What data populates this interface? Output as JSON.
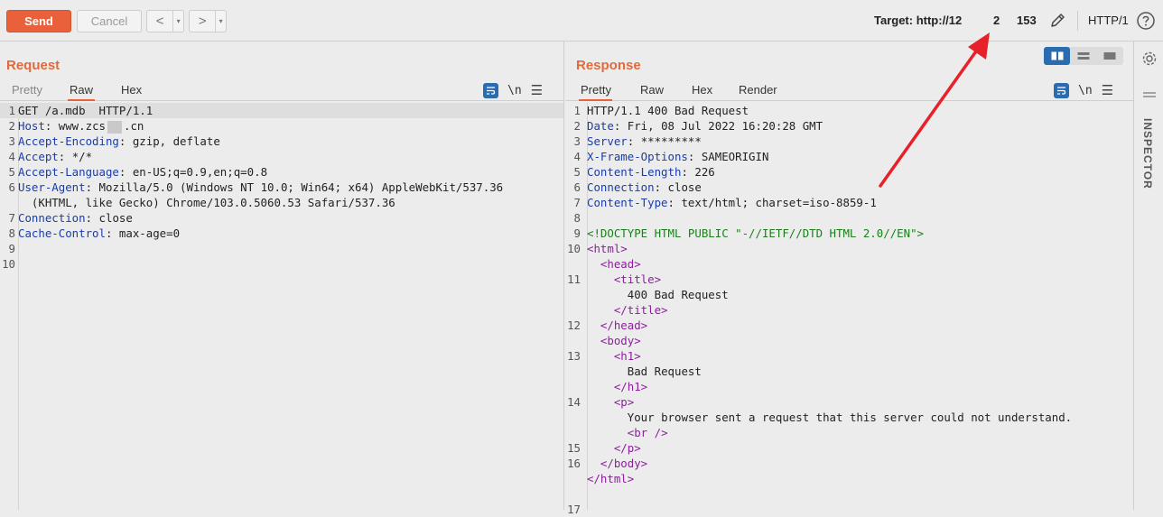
{
  "toolbar": {
    "send_label": "Send",
    "cancel_label": "Cancel",
    "back_glyph": "<",
    "forward_glyph": ">",
    "dropdown_glyph": "▾",
    "target_label": "Target: http://12",
    "count1": "2",
    "count2": "153",
    "protocol": "HTTP/1",
    "edit_icon": "pencil-icon",
    "help_icon": "question-circle-icon"
  },
  "request": {
    "title": "Request",
    "tabs": [
      "Pretty",
      "Raw",
      "Hex"
    ],
    "active_tab": "Raw",
    "newline_label": "\\n",
    "lines": [
      {
        "n": "1",
        "k": "",
        "v": "GET /a.mdb  HTTP/1.1"
      },
      {
        "n": "2",
        "k": "Host",
        "v": "www.zcs"
      },
      {
        "n": "3",
        "k": "Accept-Encoding",
        "v": "gzip, deflate"
      },
      {
        "n": "4",
        "k": "Accept",
        "v": "*/*"
      },
      {
        "n": "5",
        "k": "Accept-Language",
        "v": "en-US;q=0.9,en;q=0.8"
      },
      {
        "n": "6",
        "k": "User-Agent",
        "v": "Mozilla/5.0 (Windows NT 10.0; Win64; x64) AppleWebKit/537.36"
      },
      {
        "n": "",
        "k": "",
        "v": "(KHTML, like Gecko) Chrome/103.0.5060.53 Safari/537.36"
      },
      {
        "n": "7",
        "k": "Connection",
        "v": "close"
      },
      {
        "n": "8",
        "k": "Cache-Control",
        "v": "max-age=0"
      },
      {
        "n": "9",
        "k": "",
        "v": ""
      },
      {
        "n": "10",
        "k": "",
        "v": ""
      }
    ],
    "host_suffix": ".cn"
  },
  "response": {
    "title": "Response",
    "tabs": [
      "Pretty",
      "Raw",
      "Hex",
      "Render"
    ],
    "active_tab": "Pretty",
    "newline_label": "\\n",
    "headers": [
      {
        "n": "1",
        "k": "",
        "v": "HTTP/1.1 400 Bad Request"
      },
      {
        "n": "2",
        "k": "Date",
        "v": "Fri, 08 Jul 2022 16:20:28 GMT"
      },
      {
        "n": "3",
        "k": "Server",
        "v": "*********"
      },
      {
        "n": "4",
        "k": "X-Frame-Options",
        "v": "SAMEORIGIN"
      },
      {
        "n": "5",
        "k": "Content-Length",
        "v": "226"
      },
      {
        "n": "6",
        "k": "Connection",
        "v": "close"
      },
      {
        "n": "7",
        "k": "Content-Type",
        "v": "text/html; charset=iso-8859-1"
      },
      {
        "n": "8",
        "k": "",
        "v": ""
      }
    ],
    "body": [
      {
        "n": "9",
        "indent": "",
        "kind": "doctype",
        "text": "<!DOCTYPE HTML PUBLIC \"-//IETF//DTD HTML 2.0//EN\">"
      },
      {
        "n": "10",
        "indent": "",
        "kind": "tag",
        "text": "<html>"
      },
      {
        "n": "",
        "indent": "  ",
        "kind": "tag",
        "text": "<head>"
      },
      {
        "n": "11",
        "indent": "    ",
        "kind": "tag",
        "text": "<title>"
      },
      {
        "n": "",
        "indent": "      ",
        "kind": "text",
        "text": "400 Bad Request"
      },
      {
        "n": "",
        "indent": "    ",
        "kind": "tag",
        "text": "</title>"
      },
      {
        "n": "12",
        "indent": "  ",
        "kind": "tag",
        "text": "</head>"
      },
      {
        "n": "",
        "indent": "  ",
        "kind": "tag",
        "text": "<body>"
      },
      {
        "n": "13",
        "indent": "    ",
        "kind": "tag",
        "text": "<h1>"
      },
      {
        "n": "",
        "indent": "      ",
        "kind": "text",
        "text": "Bad Request"
      },
      {
        "n": "",
        "indent": "    ",
        "kind": "tag",
        "text": "</h1>"
      },
      {
        "n": "14",
        "indent": "    ",
        "kind": "tag",
        "text": "<p>"
      },
      {
        "n": "",
        "indent": "      ",
        "kind": "text",
        "text": "Your browser sent a request that this server could not understand."
      },
      {
        "n": "",
        "indent": "      ",
        "kind": "tag",
        "text": "<br />"
      },
      {
        "n": "15",
        "indent": "    ",
        "kind": "tag",
        "text": "</p>"
      },
      {
        "n": "16",
        "indent": "  ",
        "kind": "tag",
        "text": "</body>"
      },
      {
        "n": "",
        "indent": "",
        "kind": "tag",
        "text": "</html>"
      },
      {
        "n": "",
        "indent": "",
        "kind": "text",
        "text": ""
      },
      {
        "n": "17",
        "indent": "",
        "kind": "text",
        "text": ""
      }
    ]
  },
  "inspector": {
    "label": "INSPECTOR",
    "settings_icon": "gear-icon"
  },
  "colors": {
    "accent": "#e8613b",
    "header_key": "#1a3ca8",
    "tag": "#8a1f9a",
    "doctype": "#1a7f1a",
    "annotation_arrow": "#e8202a"
  }
}
